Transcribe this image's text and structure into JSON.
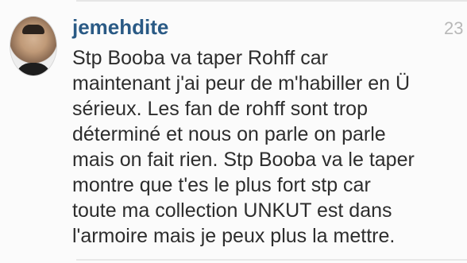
{
  "comment": {
    "username": "jemehdite",
    "timestamp": "23",
    "avatar_icon": "user-avatar-photo",
    "text_lines": [
      "Stp Booba va taper Rohff car",
      "maintenant j'ai peur de m'habiller en Ü",
      "sérieux. Les fan de rohff sont trop",
      "déterminé et nous on parle on parle",
      "mais on fait rien. Stp Booba va le taper",
      "montre que t'es le plus fort stp car",
      "toute ma collection UNKUT est dans",
      "l'armoire mais je peux plus la mettre."
    ]
  },
  "colors": {
    "username": "#2a5a85",
    "text": "#2d2d2d",
    "timestamp": "#b8b8b8",
    "background": "#fbfbfb"
  }
}
